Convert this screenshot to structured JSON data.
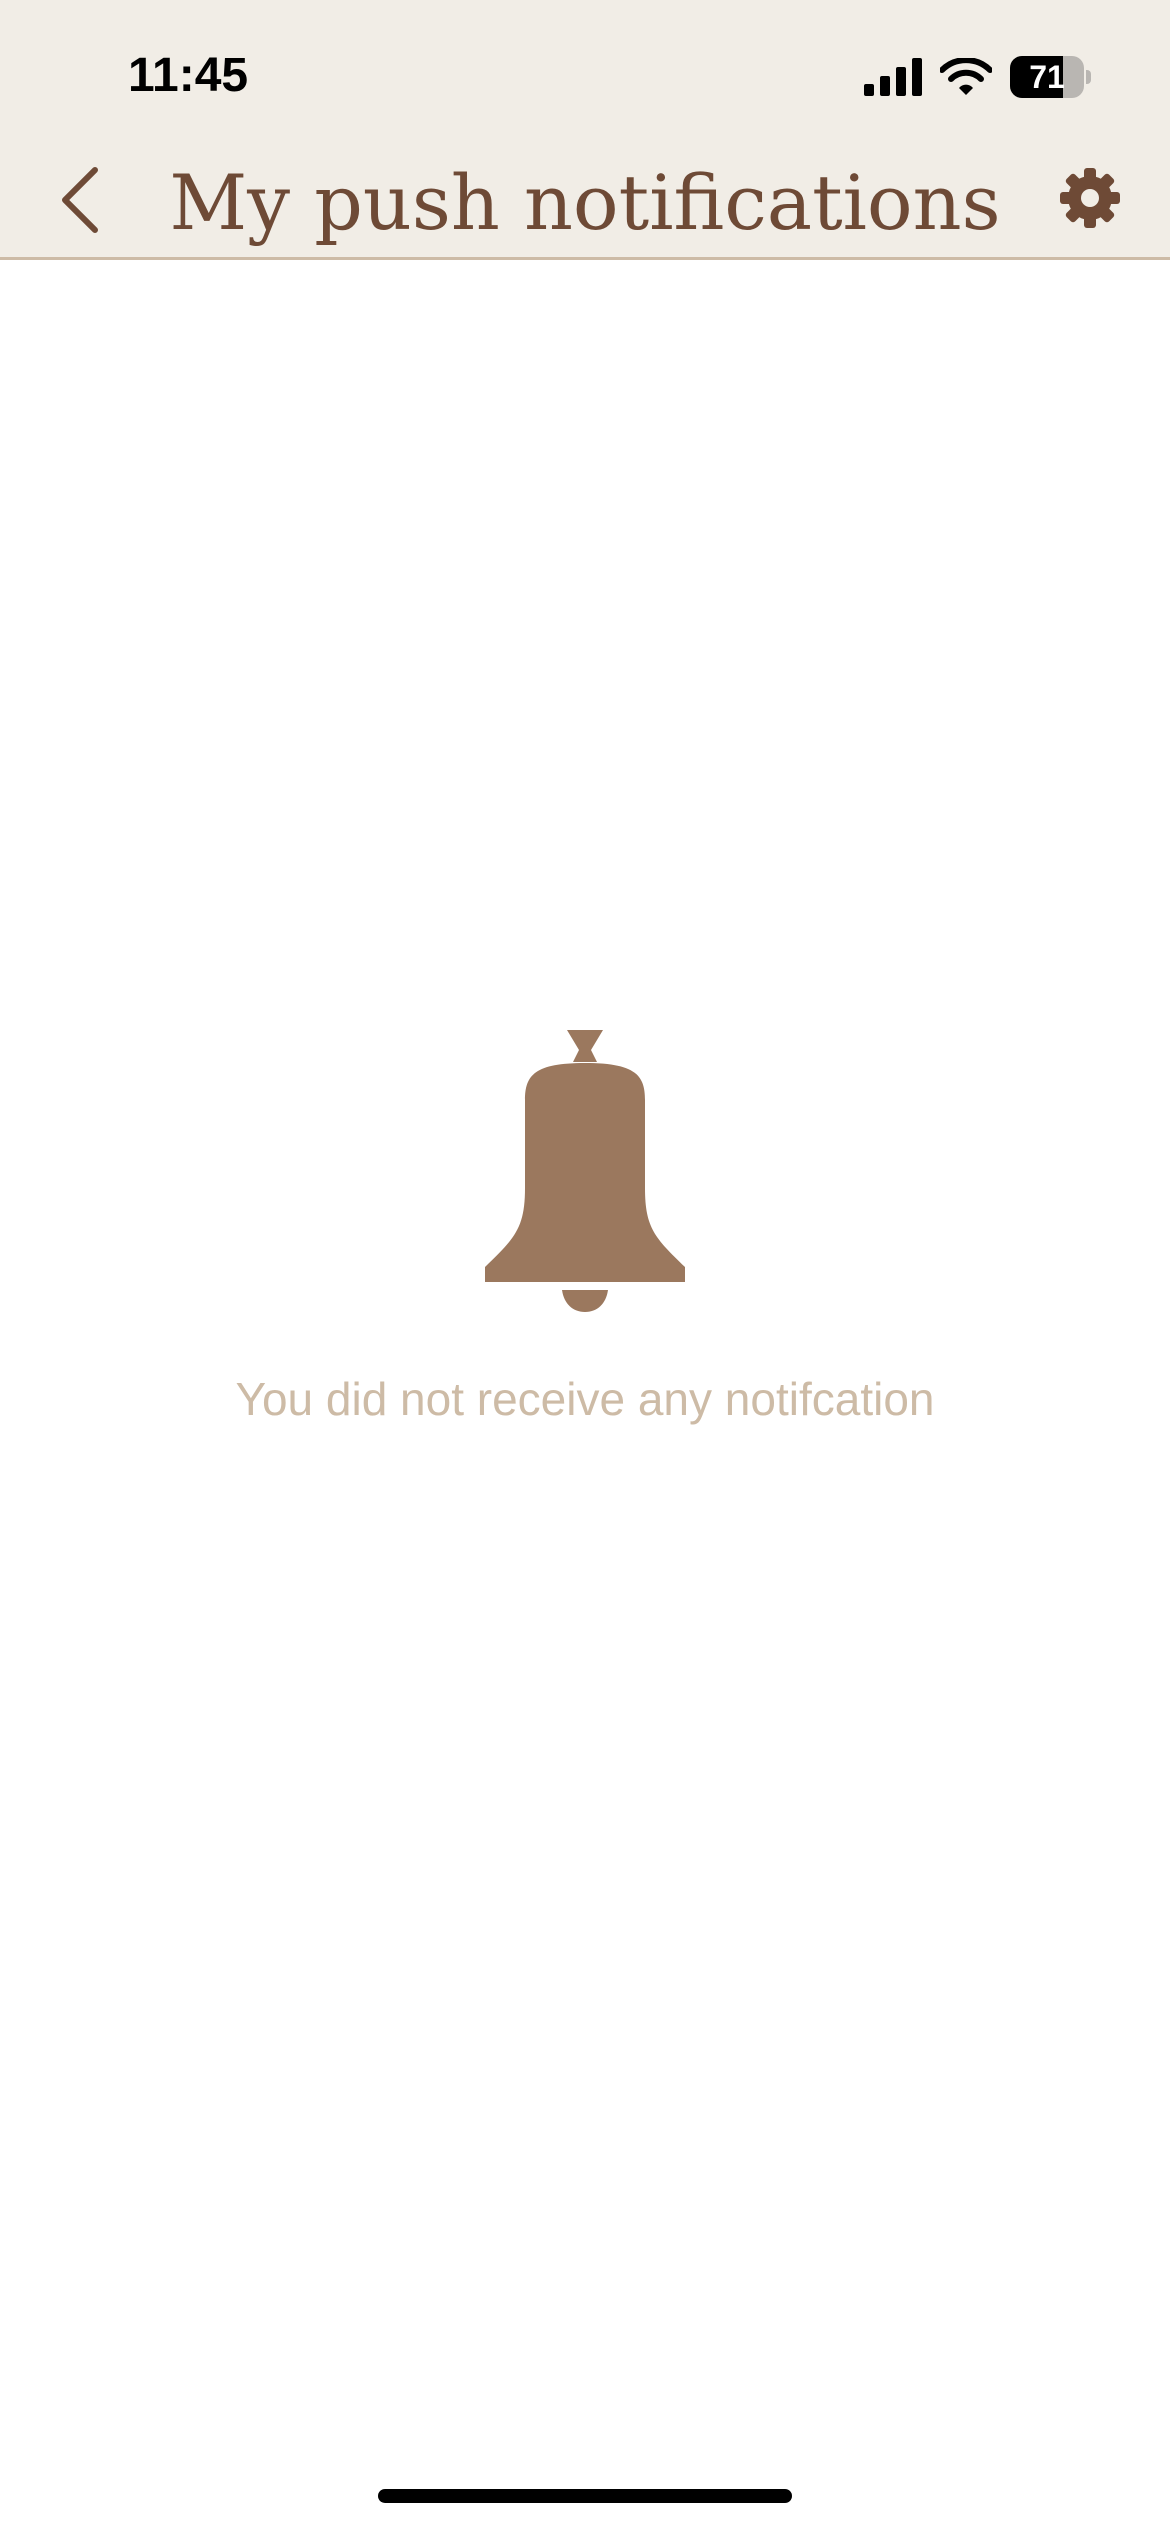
{
  "status_bar": {
    "time": "11:45",
    "battery_level": "71",
    "battery_percent": 71,
    "icons": [
      "cellular-signal-icon",
      "wifi-icon",
      "battery-icon"
    ]
  },
  "header": {
    "title": "My push notifications",
    "back_icon": "chevron-left-icon",
    "settings_icon": "gear-icon"
  },
  "empty_state": {
    "icon": "bell-icon",
    "message": "You did not receive any notifcation"
  },
  "colors": {
    "header_background": "#f1ede6",
    "title": "#6e4a36",
    "bell": "#9b785e",
    "empty_text": "#cdbba6"
  }
}
